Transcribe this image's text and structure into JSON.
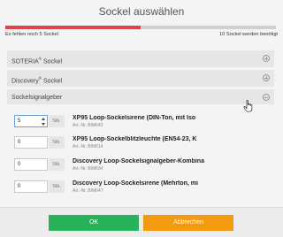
{
  "dialog": {
    "title": "Sockel auswählen"
  },
  "progress": {
    "fraction": 0.5,
    "left_text": "Es fehlen noch 5 Sockel",
    "right_text": "10 Sockel werden benötigt",
    "fill_color": "#d9454a"
  },
  "sections": [
    {
      "label": "SOTERIA",
      "reg": "®",
      "suffix": " Sockel",
      "state": "collapsed"
    },
    {
      "label": "Discovery",
      "reg": "®",
      "suffix": " Sockel",
      "state": "collapsed"
    },
    {
      "label": "Sockelsignalgeber",
      "reg": "",
      "suffix": "",
      "state": "expanded"
    }
  ],
  "items": [
    {
      "qty": "5",
      "unit": "Stk.",
      "name": "XP95 Loop-Sockelsirene (DIN-Ton, mit Iso",
      "art": "Art.-Nr. BIM643"
    },
    {
      "qty": "0",
      "unit": "Stk.",
      "name": "XP95 Loop-Sockelblitzleuchte (EN54-23, K",
      "art": "Art.-Nr. BIM614"
    },
    {
      "qty": "0",
      "unit": "Stk.",
      "name": "Discovery Loop-Sockelsignalgeber-Kombina",
      "art": "Art.-Nr. BIM634"
    },
    {
      "qty": "0",
      "unit": "Stk.",
      "name": "Discovery Loop-Sockelsirene (Mehrton, mi",
      "art": "Art.-Nr. BIM647"
    }
  ],
  "buttons": {
    "ok": "OK",
    "cancel": "Abbrechen"
  },
  "colors": {
    "ok": "#27b25a",
    "cancel": "#f39a11",
    "accent": "#d9454a"
  }
}
